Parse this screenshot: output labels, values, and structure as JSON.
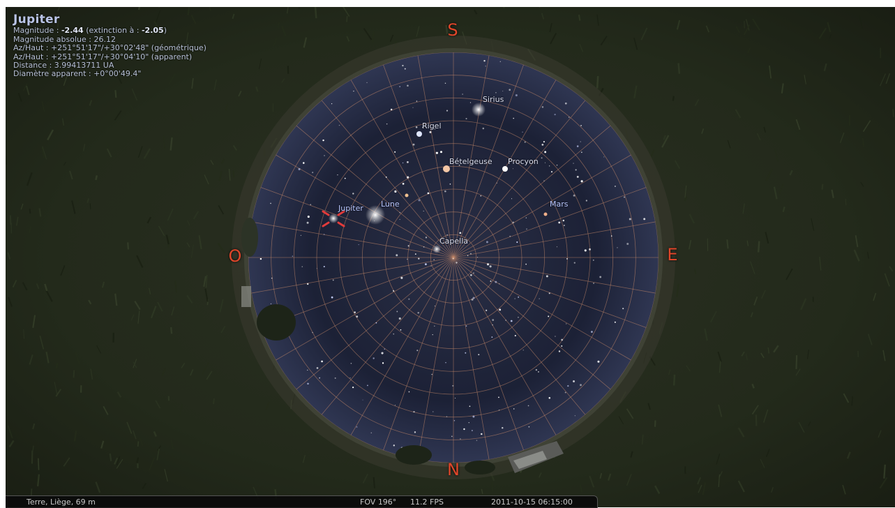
{
  "selected_object": {
    "name": "Jupiter",
    "magnitude_label": "Magnitude : ",
    "magnitude_value": "-2.44",
    "extinction_open": " (extinction à : ",
    "extinction_value": "-2.05",
    "extinction_close": ")",
    "absolute_magnitude": "Magnitude absolue : 26.12",
    "az_alt_geometric": "Az/Haut : +251°51'17\"/+30°02'48\" (géométrique)",
    "az_alt_apparent": "Az/Haut : +251°51'17\"/+30°04'10\" (apparent)",
    "distance": "Distance : 3.99413711 UA",
    "apparent_diameter": "Diamètre apparent : +0°00'49.4\""
  },
  "cardinals": {
    "south": "S",
    "north": "N",
    "west": "O",
    "east": "E"
  },
  "labels": {
    "sirius": "Sirius",
    "rigel": "Rigel",
    "betelgeuse": "Bételgeuse",
    "procyon": "Procyon",
    "jupiter": "Jupiter",
    "moon": "Lune",
    "mars": "Mars",
    "capella": "Capella"
  },
  "status": {
    "location": "Terre, Liège, 69 m",
    "fov": "FOV 196°",
    "fps": "11.2 FPS",
    "datetime": "2011-10-15   06:15:00"
  },
  "colors": {
    "cardinal": "#e0462a",
    "grid": "#c98a6a",
    "sky": "#1a1f33",
    "ground": "#1f2417",
    "selection_marker": "#e23b3b",
    "planet_label": "#b8c6ff"
  }
}
